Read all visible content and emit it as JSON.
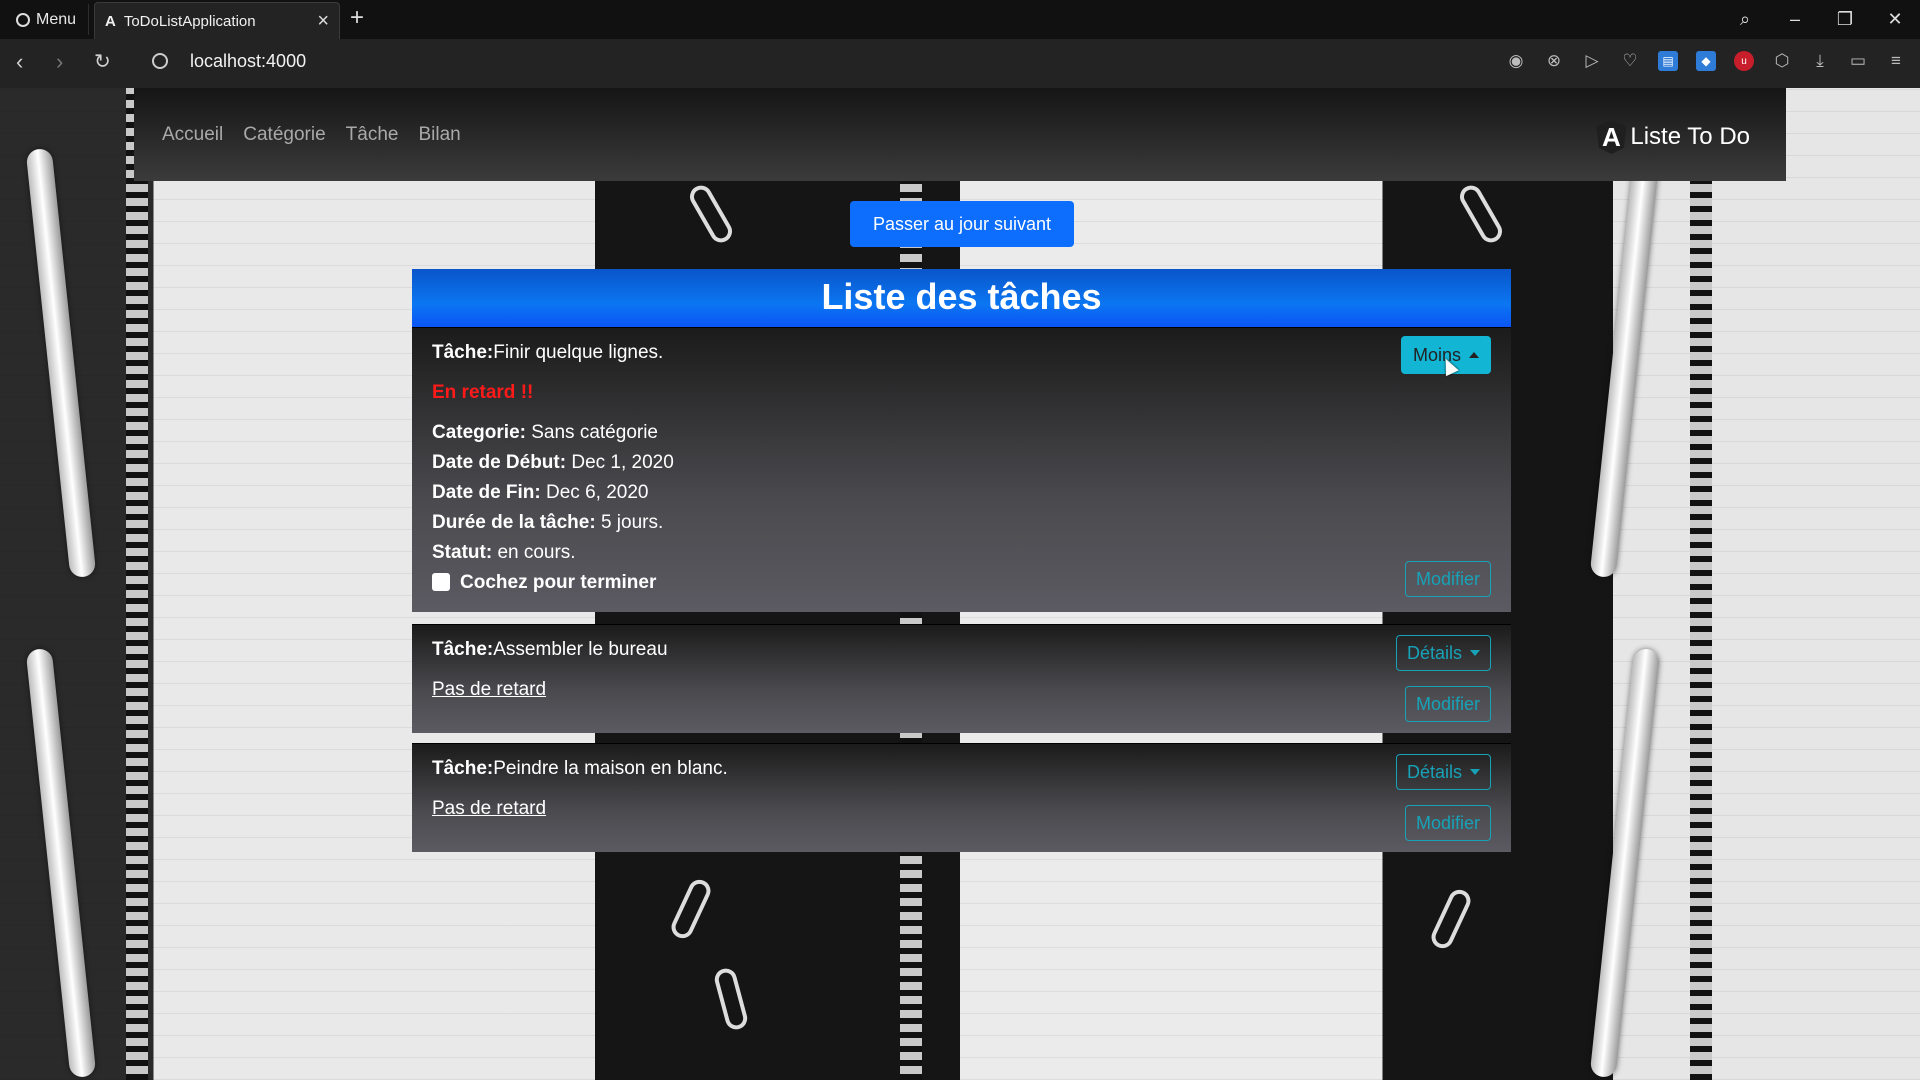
{
  "browser": {
    "menu_label": "Menu",
    "tab_title": "ToDoListApplication",
    "tab_favicon": "A",
    "url": "localhost:4000",
    "icons": [
      "back-icon",
      "forward-icon",
      "reload-icon",
      "site-info-icon",
      "camera-icon",
      "block-icon",
      "send-icon",
      "heart-icon",
      "extension-icon",
      "shield-extension-icon",
      "ublock-icon",
      "cube-icon",
      "download-icon",
      "battery-icon",
      "settings-icon"
    ]
  },
  "nav": {
    "links": [
      "Accueil",
      "Catégorie",
      "Tâche",
      "Bilan"
    ],
    "brand": "Liste To Do",
    "brand_logo": "A"
  },
  "actions": {
    "next_day": "Passer au jour suivant"
  },
  "list": {
    "title": "Liste des tâches",
    "tasks": [
      {
        "task_label": "Tâche:",
        "name": "Finir quelque lignes.",
        "status_text": "En retard !!",
        "toggle_label": "Moins",
        "details": {
          "category_label": "Categorie:",
          "category": "Sans catégorie",
          "start_label": "Date de Début:",
          "start": "Dec 1, 2020",
          "end_label": "Date de Fin:",
          "end": "Dec 6, 2020",
          "duration_label": "Durée de la tâche:",
          "duration": "5 jours.",
          "status_label": "Statut:",
          "status": "en cours.",
          "complete_label": "Cochez pour terminer"
        },
        "edit_label": "Modifier"
      },
      {
        "task_label": "Tâche:",
        "name": "Assembler le bureau",
        "status_text": "Pas de retard",
        "toggle_label": "Détails",
        "edit_label": "Modifier"
      },
      {
        "task_label": "Tâche:",
        "name": "Peindre la maison en blanc.",
        "status_text": "Pas de retard",
        "toggle_label": "Détails",
        "edit_label": "Modifier"
      }
    ]
  }
}
